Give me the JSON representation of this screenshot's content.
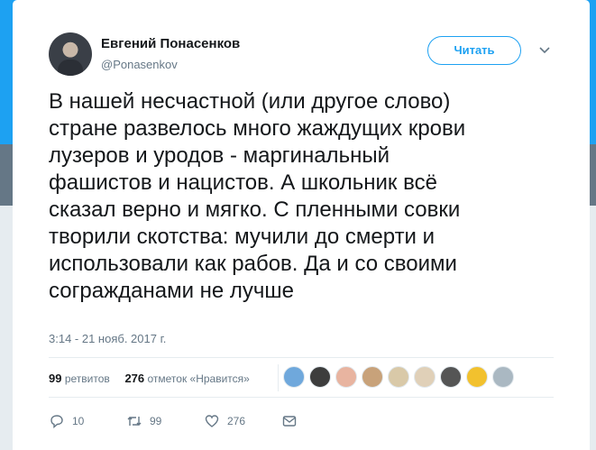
{
  "tweet": {
    "author_name": "Евгений Понасенков",
    "author_handle": "@Ponasenkov",
    "follow_label": "Читать",
    "text": "В нашей несчастной (или другое слово)\nстране развелось много жаждущих крови\nлузеров и уродов - маргинальный\nфашистов и нацистов. А школьник всё\nсказал верно и мягко. С пленными совки\nтворили скотства: мучили до смерти и\nиспользовали как рабов. Да и со своими\nсогражданами не лучше",
    "timestamp": "3:14 - 21 нояб. 2017 г."
  },
  "stats": {
    "retweets_count": "99",
    "retweets_label": "ретвитов",
    "likes_count": "276",
    "likes_label": "отметок «Нравится»"
  },
  "liker_avatars": [
    "#6fa8dc",
    "#3d3d3d",
    "#e8b4a0",
    "#c8a27a",
    "#d9c9a8",
    "#e0d0b8",
    "#555555",
    "#f2c12e",
    "#aab8c2"
  ],
  "actions": {
    "reply_count": "10",
    "retweet_count": "99",
    "like_count": "276"
  },
  "colors": {
    "accent": "#1da1f2",
    "text": "#14171a",
    "muted": "#657786"
  }
}
